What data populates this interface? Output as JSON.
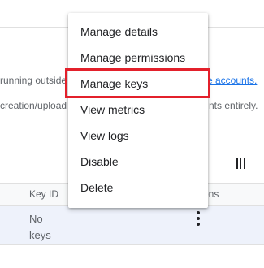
{
  "background": {
    "line1_left": "running outside",
    "line1_link": "e accounts.",
    "line2_left": "creation/upload",
    "line2_right": "nts entirely."
  },
  "table": {
    "headers": {
      "key_id": "Key ID",
      "actions": "ons"
    },
    "rows": [
      {
        "key_id": "No keys"
      }
    ]
  },
  "menu": {
    "items": [
      {
        "label": "Manage details"
      },
      {
        "label": "Manage permissions"
      },
      {
        "label": "Manage keys"
      },
      {
        "label": "View metrics"
      },
      {
        "label": "View logs"
      },
      {
        "label": "Disable"
      },
      {
        "label": "Delete"
      }
    ]
  },
  "colors": {
    "highlight": "#e3202b",
    "link": "#1a73e8",
    "selected_row": "#eef2fb"
  },
  "icons": {
    "columns": "view-column-icon",
    "row_actions": "more-vert-icon"
  }
}
